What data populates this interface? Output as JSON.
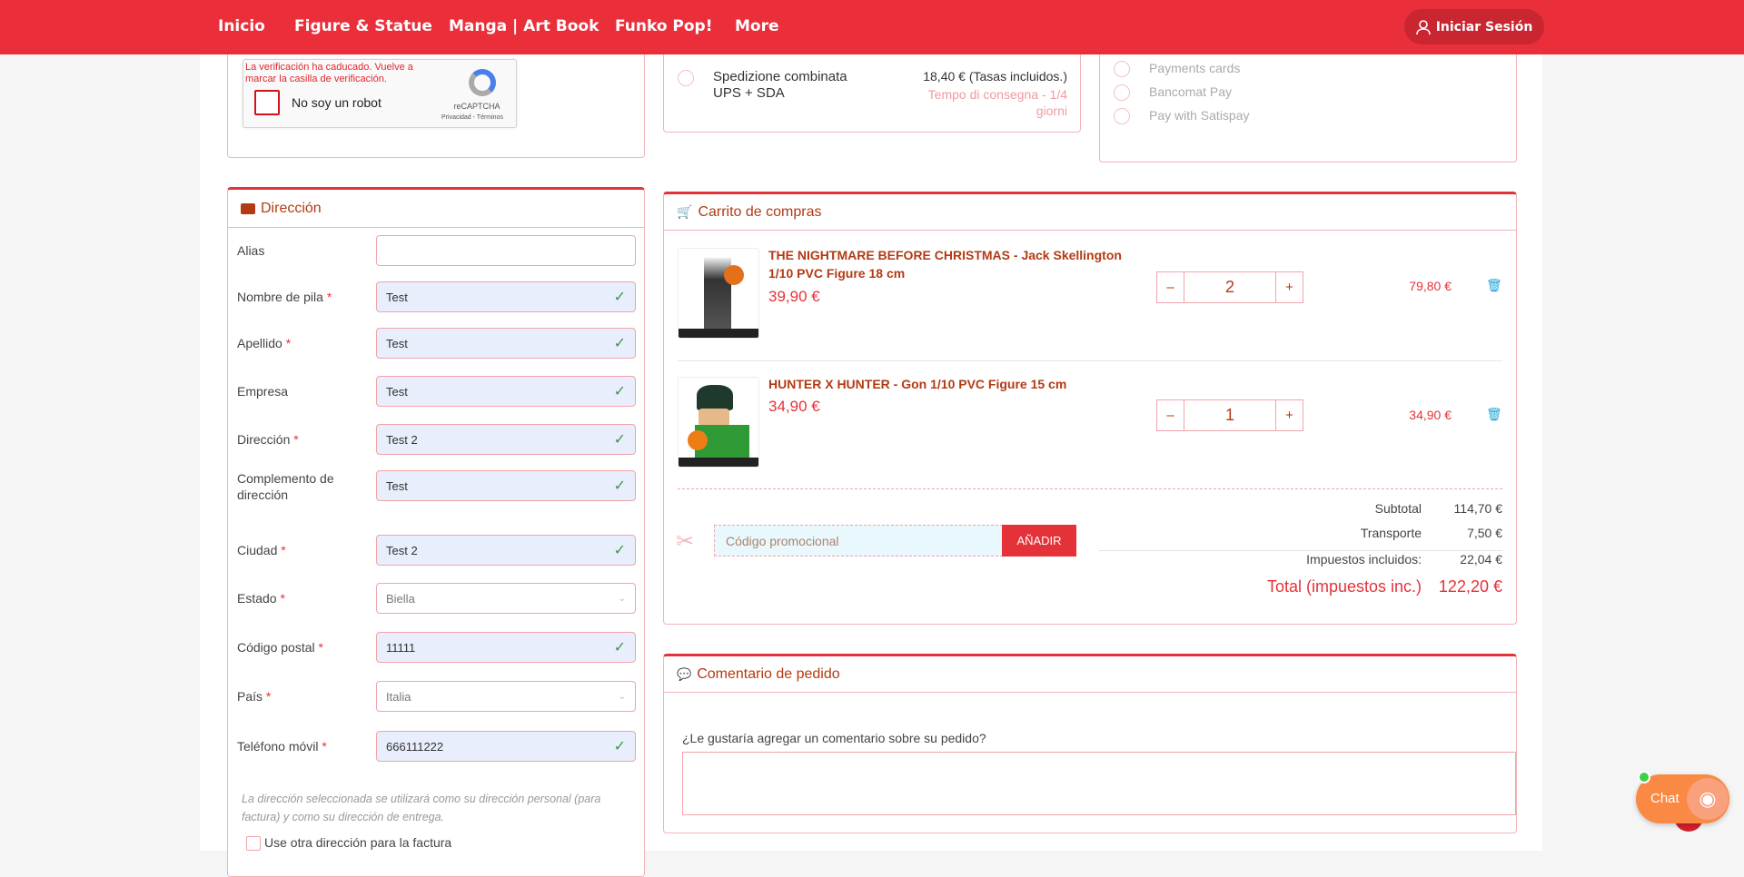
{
  "nav": {
    "items": [
      "Inicio",
      "Figure & Statue",
      "Manga | Art Book",
      "Funko Pop!",
      "More"
    ],
    "login": "Iniciar Sesión"
  },
  "captcha": {
    "error": "La verificación ha caducado. Vuelve a marcar la casilla de verificación.",
    "label": "No soy un robot",
    "brand": "reCAPTCHA",
    "links": "Privacidad - Términos"
  },
  "shipping": {
    "name": "Spedizione combinata UPS + SDA",
    "price": "18,40 € (Tasas incluidos.)",
    "delay": "Tempo di consegna - 1/4 giorni"
  },
  "payment": {
    "options": [
      "Payments cards",
      "Bancomat Pay",
      "Pay with Satispay"
    ]
  },
  "address": {
    "title": "Dirección",
    "fields": [
      {
        "label": "Alias",
        "required": false,
        "value": "",
        "type": "text"
      },
      {
        "label": "Nombre de pila",
        "required": true,
        "value": "Test",
        "type": "ok"
      },
      {
        "label": "Apellido",
        "required": true,
        "value": "Test",
        "type": "ok"
      },
      {
        "label": "Empresa",
        "required": false,
        "value": "Test",
        "type": "ok"
      },
      {
        "label": "Dirección",
        "required": true,
        "value": "Test 2",
        "type": "ok"
      },
      {
        "label": "Complemento de dirección",
        "required": false,
        "value": "Test",
        "type": "ok"
      },
      {
        "label": "Ciudad",
        "required": true,
        "value": "Test 2",
        "type": "ok"
      },
      {
        "label": "Estado",
        "required": true,
        "value": "Biella",
        "type": "select"
      },
      {
        "label": "Código postal",
        "required": true,
        "value": "11111",
        "type": "ok"
      },
      {
        "label": "País",
        "required": true,
        "value": "Italia",
        "type": "select"
      },
      {
        "label": "Teléfono móvil",
        "required": true,
        "value": "666111222",
        "type": "ok"
      }
    ],
    "note": "La dirección seleccionada se utilizará como su dirección personal (para factura) y como su dirección de entrega.",
    "other_invoice": "Use otra dirección para la factura"
  },
  "cart": {
    "title": "Carrito de compras",
    "items": [
      {
        "title": "THE NIGHTMARE BEFORE CHRISTMAS - Jack Skellington 1/10 PVC Figure 18 cm",
        "price": "39,90 €",
        "qty": "2",
        "total": "79,80 €"
      },
      {
        "title": "HUNTER X HUNTER - Gon 1/10 PVC Figure 15 cm",
        "price": "34,90 €",
        "qty": "1",
        "total": "34,90 €"
      }
    ],
    "promo_placeholder": "Código promocional",
    "promo_button": "AÑADIR",
    "subtotal_label": "Subtotal",
    "subtotal": "114,70 €",
    "shipping_label": "Transporte",
    "shipping": "7,50 €",
    "tax_label": "Impuestos incluidos:",
    "tax": "22,04 €",
    "total_label": "Total (impuestos inc.)",
    "total": "122,20 €"
  },
  "comment": {
    "title": "Comentario de pedido",
    "question": "¿Le gustaría agregar un comentario sobre su pedido?"
  },
  "chat": {
    "label": "Chat"
  }
}
